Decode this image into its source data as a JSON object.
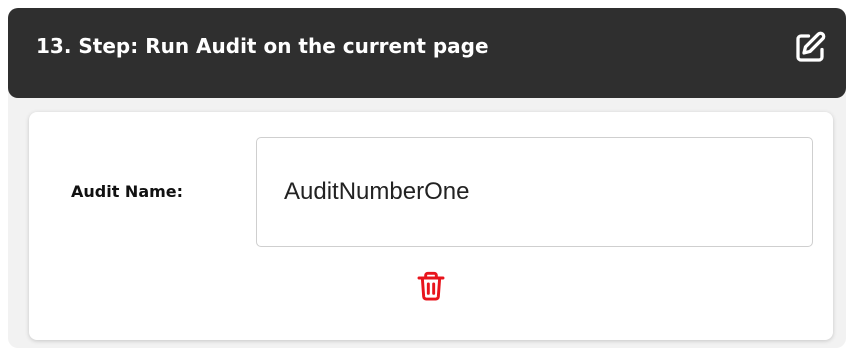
{
  "step": {
    "title": "13. Step: Run Audit on the current page",
    "edit_icon": "pencil-square-icon",
    "field": {
      "label": "Audit Name:",
      "value": "AuditNumberOne"
    },
    "delete_icon": "trash-icon"
  },
  "colors": {
    "header_background": "#2f2f2f",
    "header_text": "#ffffff",
    "delete_icon": "#e8141c",
    "panel_background": "#f2f2f2",
    "card_background": "#ffffff"
  }
}
